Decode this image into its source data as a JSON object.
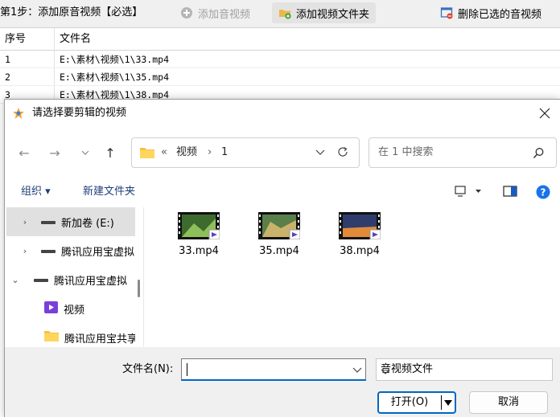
{
  "app": {
    "step_label": "第1步：添加原音视频【必选】",
    "add_av_label": "添加音视频",
    "add_folder_label": "添加视频文件夹",
    "delete_selected_label": "删除已选的音视频",
    "table": {
      "columns": [
        "序号",
        "文件名"
      ],
      "rows": [
        {
          "index": "1",
          "path": "E:\\素材\\视频\\1\\33.mp4"
        },
        {
          "index": "2",
          "path": "E:\\素材\\视频\\1\\35.mp4"
        },
        {
          "index": "3",
          "path": "E:\\素材\\视频\\1\\38.mp4"
        }
      ]
    }
  },
  "dialog": {
    "title": "请选择要剪辑的视频",
    "address": {
      "overflow": "«",
      "segments": [
        "视频",
        "1"
      ],
      "separator": "›"
    },
    "search_placeholder": "在 1 中搜索",
    "toolbar": {
      "organize_label": "组织 ▾",
      "new_folder_label": "新建文件夹"
    },
    "sidebar": [
      {
        "label": "新加卷 (E:)",
        "expander": "›",
        "icon": "drive-icon",
        "selected": true
      },
      {
        "label": "腾讯应用宝虚拟",
        "expander": "›",
        "icon": "drive-icon",
        "selected": false
      },
      {
        "label": "腾讯应用宝虚拟",
        "expander": "⌄",
        "icon": "drive-icon",
        "selected": false
      },
      {
        "label": "视频",
        "expander": "",
        "icon": "video-folder-icon",
        "selected": false
      },
      {
        "label": "腾讯应用宝共享",
        "expander": "",
        "icon": "folder-icon",
        "selected": false
      }
    ],
    "files": [
      {
        "name": "33.mp4",
        "colors": [
          "#3d6b2e",
          "#8fbf5a"
        ]
      },
      {
        "name": "35.mp4",
        "colors": [
          "#5a7f4a",
          "#c9b36a"
        ]
      },
      {
        "name": "38.mp4",
        "colors": [
          "#2e3d6b",
          "#e08a3a"
        ]
      }
    ],
    "filename_label": "文件名(N):",
    "filename_value": "",
    "filetype_value": "音视频文件",
    "open_label": "打开(O)",
    "cancel_label": "取消"
  },
  "colors": {
    "accent": "#0067c0",
    "help": "#1a73e8",
    "link": "#1f3f7a"
  }
}
